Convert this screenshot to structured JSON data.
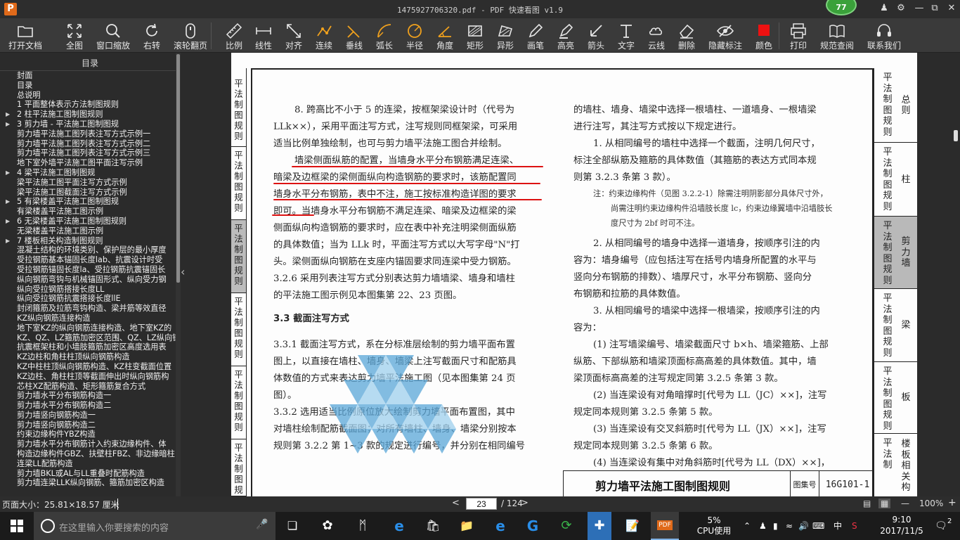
{
  "window": {
    "title": "1475927706320.pdf - PDF 快速看图 v1.9",
    "logo": "P",
    "badge": "77"
  },
  "toolbar": [
    {
      "id": "open",
      "label": "打开文档",
      "icon": "folder-icon"
    },
    {
      "id": "fit",
      "label": "全图",
      "icon": "expand-icon"
    },
    {
      "id": "zoom",
      "label": "窗口缩放",
      "icon": "magnifier-icon"
    },
    {
      "id": "rotate",
      "label": "右转",
      "icon": "rotate-icon"
    },
    {
      "id": "wheel",
      "label": "滚轮翻页",
      "icon": "mouse-icon"
    },
    {
      "id": "scale",
      "label": "比例",
      "icon": "ruler-icon"
    },
    {
      "id": "linear",
      "label": "线性",
      "icon": "linear-icon"
    },
    {
      "id": "align",
      "label": "对齐",
      "icon": "align-icon"
    },
    {
      "id": "chain",
      "label": "连续",
      "icon": "chain-icon"
    },
    {
      "id": "perp",
      "label": "垂线",
      "icon": "perpendicular-icon"
    },
    {
      "id": "arc",
      "label": "弧长",
      "icon": "arc-icon"
    },
    {
      "id": "radius",
      "label": "半径",
      "icon": "radius-icon"
    },
    {
      "id": "angle",
      "label": "角度",
      "icon": "angle-icon"
    },
    {
      "id": "rect",
      "label": "矩形",
      "icon": "rectangle-icon"
    },
    {
      "id": "poly",
      "label": "异形",
      "icon": "polygon-icon"
    },
    {
      "id": "pen",
      "label": "画笔",
      "icon": "pen-icon"
    },
    {
      "id": "hl",
      "label": "高亮",
      "icon": "highlighter-icon"
    },
    {
      "id": "arrow",
      "label": "箭头",
      "icon": "arrow-icon"
    },
    {
      "id": "text",
      "label": "文字",
      "icon": "text-icon"
    },
    {
      "id": "cloud",
      "label": "云线",
      "icon": "cloud-icon"
    },
    {
      "id": "erase",
      "label": "删除",
      "icon": "eraser-icon"
    },
    {
      "id": "hide",
      "label": "隐藏标注",
      "icon": "eye-slash-icon"
    },
    {
      "id": "color",
      "label": "颜色",
      "icon": "color-swatch-icon"
    },
    {
      "id": "print",
      "label": "打印",
      "icon": "printer-icon"
    },
    {
      "id": "spec",
      "label": "规范查阅",
      "icon": "book-icon"
    },
    {
      "id": "contact",
      "label": "联系我们",
      "icon": "headset-icon"
    }
  ],
  "colors": {
    "accent": "#e06a1a",
    "swatch": "#ee1111",
    "underline": "#dd1111",
    "badge": "#3aa13a"
  },
  "sidebar": {
    "title": "目录",
    "items": [
      {
        "t": "封面",
        "a": ""
      },
      {
        "t": "目录",
        "a": ""
      },
      {
        "t": "总说明",
        "a": ""
      },
      {
        "t": "1 平面整体表示方法制图规则",
        "a": ""
      },
      {
        "t": "2 柱平法施工图制图规则",
        "a": "▶"
      },
      {
        "t": "3 剪力墙 - 平法施工图制图规",
        "a": "▶"
      },
      {
        "t": "剪力墙平法施工图列表注写方式示例一",
        "a": ""
      },
      {
        "t": "剪力墙平法施工图列表注写方式示例二",
        "a": ""
      },
      {
        "t": "剪力墙平法施工图列表注写方式示例三",
        "a": ""
      },
      {
        "t": "地下室外墙平法施工图平面注写示例",
        "a": ""
      },
      {
        "t": "4 梁平法施工图制图规",
        "a": "▶"
      },
      {
        "t": "梁平法施工图平面注写方式示例",
        "a": ""
      },
      {
        "t": "梁平法施工图截面注写方式示例",
        "a": ""
      },
      {
        "t": "5 有梁楼盖平法施工图制图规",
        "a": "▶"
      },
      {
        "t": "有梁楼盖平法施工图示例",
        "a": ""
      },
      {
        "t": "6 无梁楼盖平法施工图制图规则",
        "a": "▶"
      },
      {
        "t": "无梁楼盖平法施工图示例",
        "a": ""
      },
      {
        "t": "7 楼板相关构造制图规则",
        "a": "▶"
      },
      {
        "t": "混凝土结构的环境类别、保护层的最小厚度",
        "a": ""
      },
      {
        "t": "受拉钢筋基本锚固长度lab、抗震设计时受",
        "a": ""
      },
      {
        "t": "受拉钢筋锚固长度la、受拉钢筋抗震锚固长",
        "a": ""
      },
      {
        "t": "纵向钢筋弯钩与机械锚固形式、纵向受力钢",
        "a": ""
      },
      {
        "t": "纵向受拉钢筋搭接长度LL",
        "a": ""
      },
      {
        "t": "纵向受拉钢筋抗震搭接长度llE",
        "a": ""
      },
      {
        "t": "封闭箍筋及拉筋弯钩构造、梁并筋等效直径",
        "a": ""
      },
      {
        "t": "KZ纵向钢筋连接构造",
        "a": ""
      },
      {
        "t": "地下室KZ的纵向钢筋连接构造、地下室KZ的",
        "a": ""
      },
      {
        "t": "KZ、QZ、LZ箍筋加密区范围、QZ、LZ纵向钢",
        "a": ""
      },
      {
        "t": "抗震框架柱和小墙肢箍筋加密区高度选用表",
        "a": ""
      },
      {
        "t": "KZ边柱和角柱柱顶纵向钢筋构造",
        "a": ""
      },
      {
        "t": "KZ中柱柱顶纵向钢筋构造、KZ柱变截面位置",
        "a": ""
      },
      {
        "t": "KZ边柱、角柱柱顶等截面伸出时纵向钢筋构",
        "a": ""
      },
      {
        "t": "芯柱XZ配筋构造、矩形箍筋复合方式",
        "a": ""
      },
      {
        "t": "剪力墙水平分布钢筋构造一",
        "a": ""
      },
      {
        "t": "剪力墙水平分布钢筋构造二",
        "a": ""
      },
      {
        "t": "剪力墙竖向钢筋构造一",
        "a": ""
      },
      {
        "t": "剪力墙竖向钢筋构造二",
        "a": ""
      },
      {
        "t": "约束边缘构件YBZ构造",
        "a": ""
      },
      {
        "t": "剪力墙水平分布钢筋计入约束边缘构件、体",
        "a": ""
      },
      {
        "t": "构造边缘构件GBZ、扶壁柱FBZ、非边缘暗柱",
        "a": ""
      },
      {
        "t": "连梁LL配筋构造",
        "a": ""
      },
      {
        "t": "剪力墙BKL或AL与LL重叠时配筋构造",
        "a": ""
      },
      {
        "t": "剪力墙连梁LLK纵向钢筋、箍筋加密区构造",
        "a": ""
      }
    ]
  },
  "page": {
    "left_strip": [
      "平法制图规则",
      "平法制图规则",
      "平法制图规则",
      "平法制图规则",
      "平法制图规则",
      "平法制图规则"
    ],
    "left_col": [
      "8. 跨高比不小于 5 的连梁，按框架梁设计时（代号为",
      "LLk××），采用平面注写方式，注写规则同框架梁，可采用",
      "适当比例单独绘制，也可与剪力墙平法施工图合并绘制。",
      "墙梁侧面纵筋的配置，当墙身水平分布钢筋满足连梁、",
      "暗梁及边框梁的梁侧面纵向构造钢筋的要求时，该筋配置同",
      "墙身水平分布钢筋，表中不注，施工按标准构造详图的要求",
      "即可。当墙身水平分布钢筋不满足连梁、暗梁及边框梁的梁",
      "侧面纵向构造钢筋的要求时，应在表中补充注明梁侧面纵筋",
      "的具体数值；当为 LLk 时，平面注写方式以大写字母\"N\"打",
      "头。梁侧面纵向钢筋在支座内锚固要求同连梁中受力钢筋。",
      "3.2.6 采用列表注写方式分别表达剪力墙墙梁、墙身和墙柱",
      "的平法施工图示例见本图集第 22、23 页图。",
      "3.3 截面注写方式",
      "3.3.1 截面注写方式，系在分标准层绘制的剪力墙平面布置",
      "图上，以直接在墙柱、墙身、墙梁上注写截面尺寸和配筋具",
      "体数值的方式来表达剪力墙平法施工图（见本图集第 24 页",
      "图）。",
      "3.3.2 选用适当比例原位放大绘制剪力墙平面布置图，其中",
      "对墙柱绘制配筋截面图；对所有墙柱、墙身、墙梁分别按本",
      "规则第 3.2.2 第 1~3 款的规定进行编号，并分别在相同编号"
    ],
    "right_col": [
      "的墙柱、墙身、墙梁中选择一根墙柱、一道墙身、一根墙梁",
      "进行注写，其注写方式按以下规定进行。",
      "1. 从相同编号的墙柱中选择一个截面，注明几何尺寸，",
      "标注全部纵筋及箍筋的具体数值（其箍筋的表达方式同本规",
      "则第 3.2.3 条第 3 款）。",
      "2. 从相同编号的墙身中选择一道墙身，按顺序引注的内",
      "容为：墙身编号（应包括注写在括号内墙身所配置的水平与",
      "竖向分布钢筋的排数）、墙厚尺寸，水平分布钢筋、竖向分",
      "布钢筋和拉筋的具体数值。",
      "3. 从相同编号的墙梁中选择一根墙梁，按顺序引注的内",
      "容为：",
      "(1) 注写墙梁编号、墙梁截面尺寸 b×h、墙梁箍筋、上部",
      "纵筋、下部纵筋和墙梁顶面标高高差的具体数值。其中，墙",
      "梁顶面标高高差的注写规定同第 3.2.5 条第 3 款。",
      "(2) 当连梁设有对角暗撑时[代号为 LL（JC）××]，注写",
      "规定同本规则第 3.2.5 条第 5 款。",
      "(3) 当连梁设有交叉斜筋时[代号为 LL（JX）××]，注写",
      "规定同本规则第 3.2.5 条第 6 款。",
      "(4) 当连梁设有集中对角斜筋时[代号为 LL（DX）××]，"
    ],
    "note_lines": [
      "注：约束边缘构件（见图 3.2.2-1）除需注明阴影部分具体尺寸外，",
      "尚需注明约束边缘构件沿墙肢长度 lc，约束边缘翼墙中沿墙肢长",
      "度尺寸为 2bf 时可不注。"
    ],
    "right_tabs": [
      {
        "a": "平法制图规则",
        "b": "总则"
      },
      {
        "a": "平法制图规则",
        "b": "柱"
      },
      {
        "a": "平法制图规则",
        "b": "剪力墙"
      },
      {
        "a": "平法制图规则",
        "b": "梁"
      },
      {
        "a": "平法制图规则",
        "b": "板"
      },
      {
        "a": "平法制",
        "b": "楼板相关构"
      }
    ],
    "footer_title": "剪力墙平法施工图制图规则",
    "footer_label": "图集号",
    "footer_code": "16G101-1"
  },
  "status": {
    "page_size": "页面大小：25.81×18.57 厘米",
    "prev": "<",
    "next": ">",
    "page": "23",
    "total": "/ 124",
    "zoom_minus": "—",
    "zoom": "100%",
    "zoom_plus": "+"
  },
  "taskbar": {
    "search_placeholder": "在这里输入你要搜索的内容",
    "cpu_percent": "5%",
    "cpu_label": "CPU使用",
    "ime": "中",
    "time": "9:10",
    "date": "2017/11/5",
    "notifications": "2"
  }
}
